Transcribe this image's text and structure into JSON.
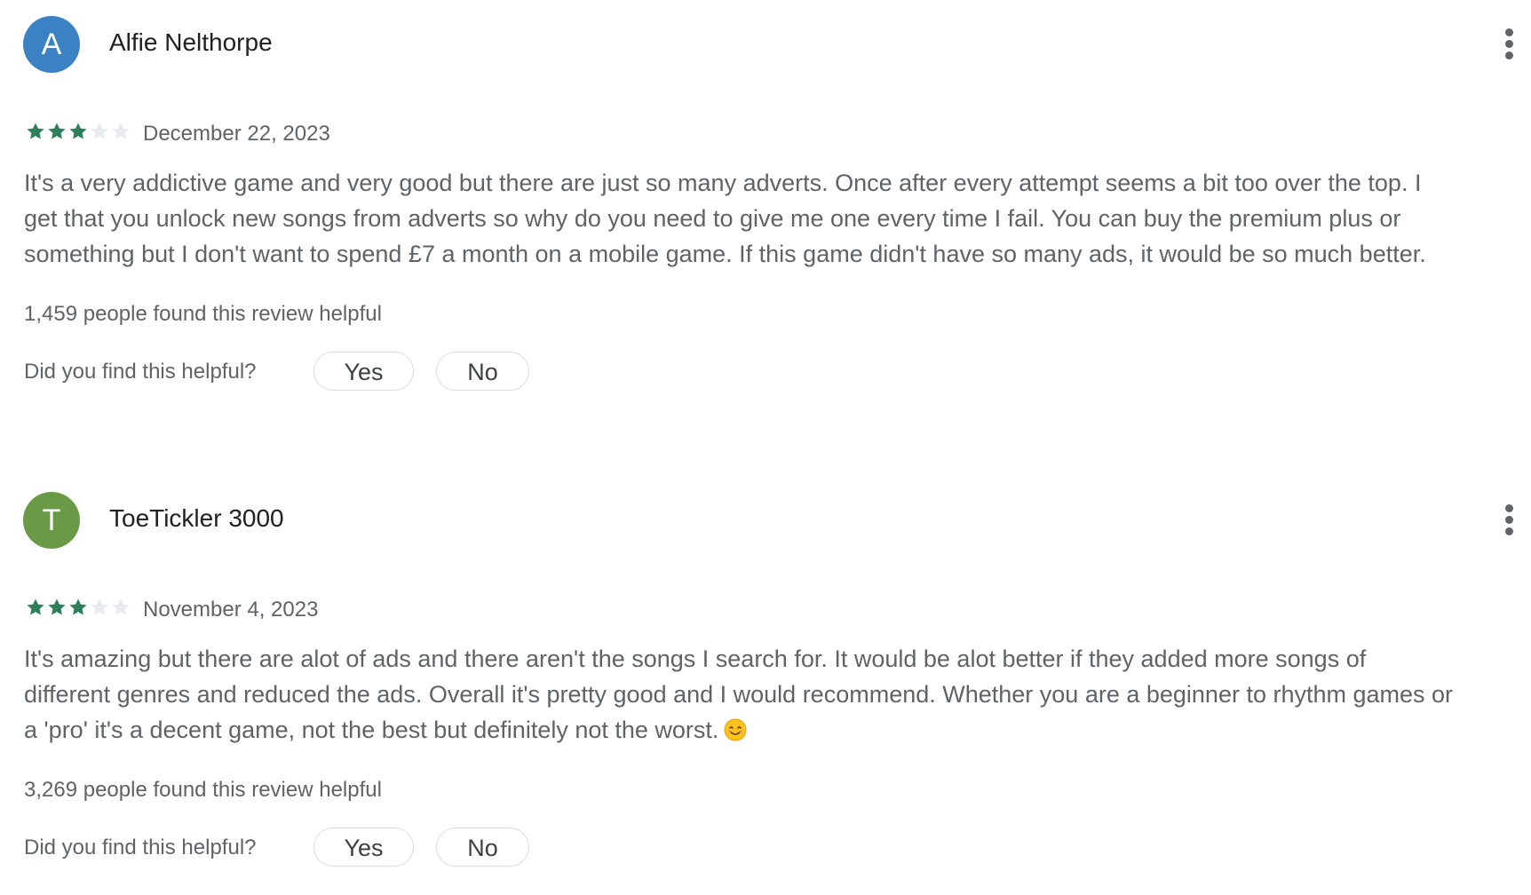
{
  "reviews": [
    {
      "avatar_letter": "A",
      "avatar_color": "#3b82c4",
      "author": "Alfie Nelthorpe",
      "rating": 3,
      "max_rating": 5,
      "date": "December 22, 2023",
      "body_lines": [
        "It's a very addictive game and very good but there are just so many adverts. Once after every attempt seems a bit too over the top. I",
        "get that you unlock new songs from adverts so why do you need to give me one every time I fail. You can buy the premium plus or",
        "something but I don't want to spend £7 a month on a mobile game. If this game didn't have so many ads, it would be so much better."
      ],
      "helpful_count": "1,459 people found this review helpful",
      "helpful_prompt": "Did you find this helpful?",
      "yes_label": "Yes",
      "no_label": "No",
      "menu_icon": "more-vert-icon"
    },
    {
      "avatar_letter": "T",
      "avatar_color": "#6a9a45",
      "author": "ToeTickler 3000",
      "rating": 3,
      "max_rating": 5,
      "date": "November 4, 2023",
      "body_lines": [
        "It's amazing but there are alot of ads and there aren't the songs I search for. It would be alot better if they added more songs of",
        "different genres and reduced the ads. Overall it's pretty good and I would recommend. Whether you are a beginner to rhythm games or",
        "a 'pro' it's a decent game, not the best but definitely not the worst."
      ],
      "body_emoji": "smiling-face-emoji",
      "helpful_count": "3,269 people found this review helpful",
      "helpful_prompt": "Did you find this helpful?",
      "yes_label": "Yes",
      "no_label": "No",
      "menu_icon": "more-vert-icon"
    }
  ],
  "colors": {
    "star_filled": "#2e7d5b",
    "star_empty": "#e8eaed"
  }
}
